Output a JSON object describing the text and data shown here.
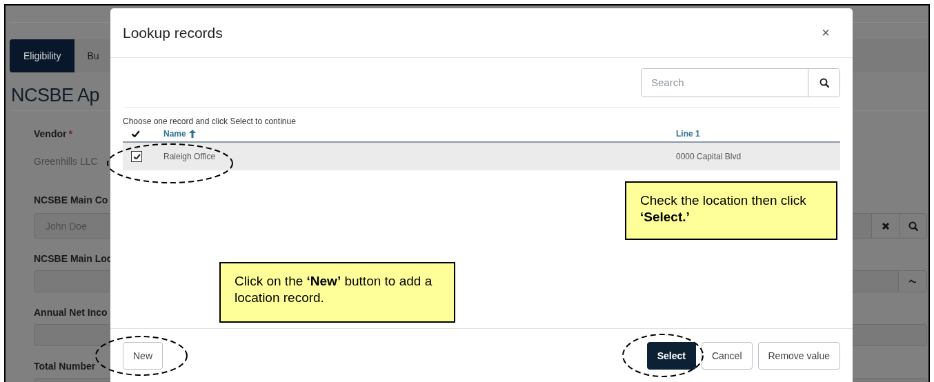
{
  "page": {
    "tabs": [
      {
        "label": "Eligibility",
        "selected": true
      },
      {
        "label": "Bu",
        "selected": false
      }
    ],
    "heading": "NCSBE Ap",
    "fields": [
      {
        "kind": "readonly",
        "label": "Vendor",
        "required_mark": "*",
        "value": "Greenhills LLC"
      },
      {
        "kind": "lookup",
        "label": "NCSBE Main Co",
        "placeholder": "John Doe"
      },
      {
        "kind": "dropdown",
        "label": "NCSBE Main Loc"
      },
      {
        "kind": "text",
        "label": "Annual Net Inco"
      },
      {
        "kind": "text",
        "label": "Total Number"
      }
    ]
  },
  "dialog": {
    "title": "Lookup records",
    "close": "×",
    "search": {
      "placeholder": "Search"
    },
    "instruction": "Choose one record and click Select to continue",
    "columns": [
      {
        "label": "Name",
        "sorted": true
      },
      {
        "label": "Line 1",
        "sorted": false
      }
    ],
    "rows": [
      {
        "selected": true,
        "cells": [
          "Raleigh Office",
          "0000 Capital Blvd"
        ]
      }
    ],
    "footer_left": [
      {
        "label": "New",
        "kind": "secondary"
      }
    ],
    "footer_right": [
      {
        "label": "Select",
        "kind": "primary"
      },
      {
        "label": "Cancel",
        "kind": "secondary"
      },
      {
        "label": "Remove value",
        "kind": "secondary"
      }
    ]
  },
  "callouts": [
    {
      "text": "Check the location then click **‘Select.’**"
    },
    {
      "text": "Click on the **‘New’** button to add a location record."
    }
  ]
}
